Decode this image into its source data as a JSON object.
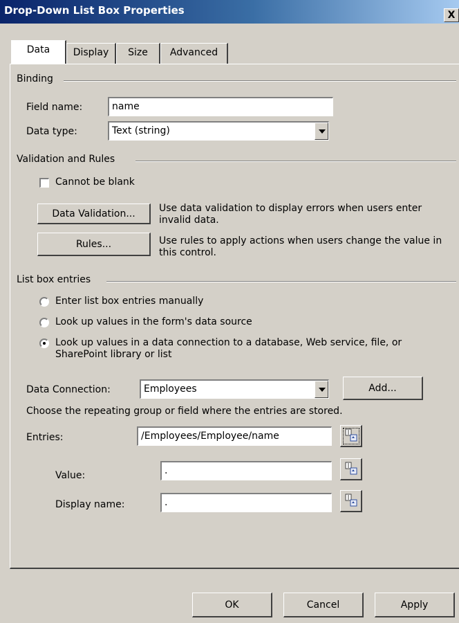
{
  "window": {
    "title": "Drop-Down List Box Properties",
    "close_symbol": "X"
  },
  "tabs": [
    {
      "label": "Data",
      "active": true
    },
    {
      "label": "Display",
      "active": false
    },
    {
      "label": "Size",
      "active": false
    },
    {
      "label": "Advanced",
      "active": false
    }
  ],
  "binding": {
    "section_label": "Binding",
    "field_name_label": "Field name:",
    "field_name_value": "name",
    "data_type_label": "Data type:",
    "data_type_value": "Text (string)"
  },
  "validation": {
    "section_label": "Validation and Rules",
    "cannot_blank_label": "Cannot be blank",
    "cannot_blank_checked": false,
    "data_validation_button": "Data Validation...",
    "data_validation_desc": "Use data validation to display errors when users enter invalid data.",
    "rules_button": "Rules...",
    "rules_desc": "Use rules to apply actions when users change the value in this control."
  },
  "list_entries": {
    "section_label": "List box entries",
    "options": [
      {
        "label": "Enter list box entries manually",
        "selected": false
      },
      {
        "label": "Look up values in the form's data source",
        "selected": false
      },
      {
        "label": "Look up values in a data connection to a database, Web service, file, or SharePoint library or list",
        "selected": true
      }
    ],
    "data_connection_label": "Data Connection:",
    "data_connection_value": "Employees",
    "add_button": "Add...",
    "choose_text": "Choose the repeating group or field where the entries are stored.",
    "entries_label": "Entries:",
    "entries_value": "/Employees/Employee/name",
    "value_label": "Value:",
    "value_value": ".",
    "display_name_label": "Display name:",
    "display_name_value": "."
  },
  "footer": {
    "ok": "OK",
    "cancel": "Cancel",
    "apply": "Apply"
  }
}
